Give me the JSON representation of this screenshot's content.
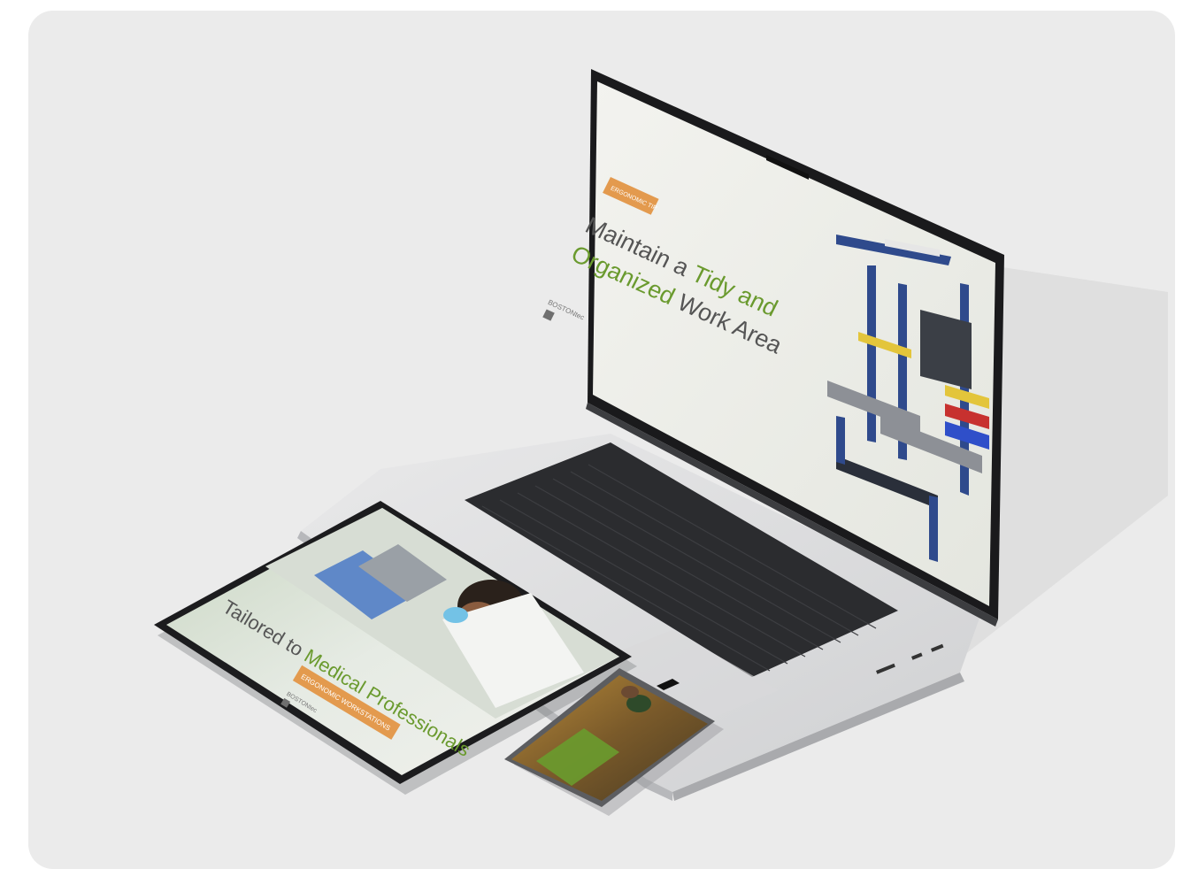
{
  "colors": {
    "background": "#ffffff",
    "card": "#ebebeb",
    "accent_green": "#6a9a2e",
    "accent_orange": "#e39a4e",
    "workstation_blue": "#2f4a8c"
  },
  "laptop": {
    "tag": "ERGONOMIC TIP",
    "headline_line1_a": "Maintain a ",
    "headline_line1_b": "Tidy and",
    "headline_line2_a": "Organized",
    "headline_line2_b": " Work Area",
    "brand": "BOSTONtec"
  },
  "tablet": {
    "tag": "ERGONOMIC WORKSTATIONS",
    "headline_a": "Tailored to ",
    "headline_b": "Medical Professionals",
    "brand": "BOSTONtec"
  }
}
